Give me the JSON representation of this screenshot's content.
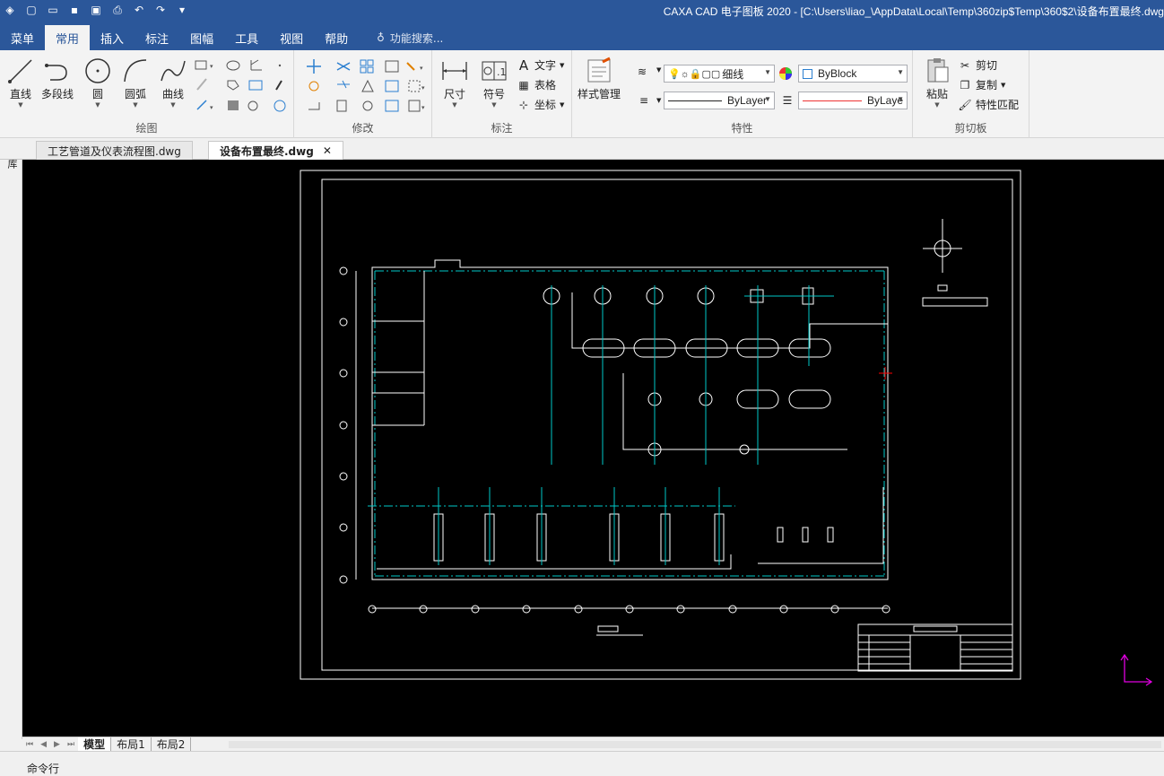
{
  "window": {
    "title": "CAXA CAD 电子图板 2020 - [C:\\Users\\liao_\\AppData\\Local\\Temp\\360zip$Temp\\360$2\\设备布置最终.dwg"
  },
  "menubar": {
    "tabs": [
      {
        "label": "菜单"
      },
      {
        "label": "常用"
      },
      {
        "label": "插入"
      },
      {
        "label": "标注"
      },
      {
        "label": "图幅"
      },
      {
        "label": "工具"
      },
      {
        "label": "视图"
      },
      {
        "label": "帮助"
      }
    ],
    "search_placeholder": "功能搜索..."
  },
  "ribbon": {
    "draw": {
      "label": "绘图",
      "line": "直线",
      "polyline": "多段线",
      "circle": "圆",
      "arc": "圆弧",
      "curve": "曲线"
    },
    "modify": {
      "label": "修改"
    },
    "annotate": {
      "label": "标注",
      "dimension": "尺寸",
      "symbol": "符号",
      "text": "文字",
      "table": "表格",
      "coordinate": "坐标"
    },
    "properties": {
      "label": "特性",
      "style_manager": "样式管理",
      "linewidth": "细线",
      "color": "ByBlock",
      "linetype": "ByLayer",
      "linetype2": "ByLaye"
    },
    "clipboard": {
      "label": "剪切板",
      "paste": "粘贴",
      "cut": "剪切",
      "copy": "复制",
      "match": "特性匹配"
    }
  },
  "doc_tabs": [
    {
      "label": "工艺管道及仪表流程图.dwg"
    },
    {
      "label": "设备布置最终.dwg"
    }
  ],
  "sidebar": {
    "label": "图库"
  },
  "layout_tabs": [
    {
      "label": "模型"
    },
    {
      "label": "布局1"
    },
    {
      "label": "布局2"
    }
  ],
  "cmdline": {
    "label": "命令行"
  },
  "colors": {
    "titlebar": "#2b579a",
    "canvas": "#000000",
    "cad_white": "#ffffff",
    "cad_cyan": "#00c8c8",
    "cad_red": "#ff0000",
    "ucs": "#e000e0"
  }
}
